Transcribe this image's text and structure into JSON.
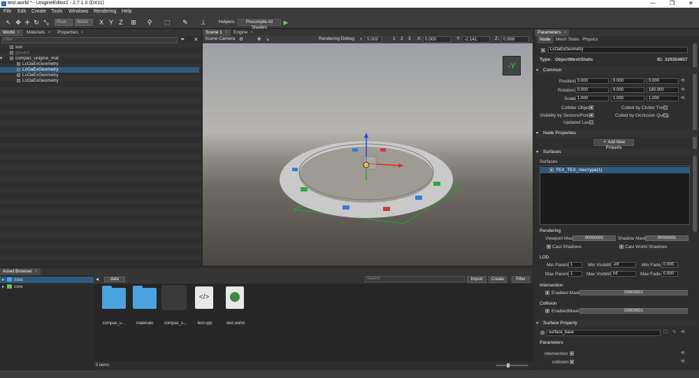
{
  "window": {
    "title": "test.world * - UnigineEditor2 - 2.7.1.0 (DX11)",
    "controls": [
      "—",
      "❐",
      "✕"
    ]
  },
  "menu": [
    "File",
    "Edit",
    "Create",
    "Tools",
    "Windows",
    "Rendering",
    "Help"
  ],
  "toolbar": {
    "pivot": "Pivot",
    "space": "World",
    "axes": [
      "X",
      "Y",
      "Z"
    ],
    "helpers_label": "Helpers",
    "precompile_label": "Precompile All Shaders"
  },
  "world_panel": {
    "tabs": [
      "World",
      "Materials",
      "Properties"
    ],
    "filter_placeholder": "Filter",
    "nodes": [
      {
        "label": "sun",
        "indent": 1,
        "dim": false,
        "selected": false
      },
      {
        "label": "ground",
        "indent": 1,
        "dim": true,
        "selected": false
      },
      {
        "label": "compas_unigine_mat",
        "indent": 1,
        "dim": false,
        "selected": false
      },
      {
        "label": "LcOaExGeometry",
        "indent": 2,
        "dim": false,
        "selected": false
      },
      {
        "label": "LcOaExGeometry",
        "indent": 2,
        "dim": false,
        "selected": true
      },
      {
        "label": "LcOaExGeometry",
        "indent": 2,
        "dim": false,
        "selected": false
      },
      {
        "label": "LcOaExGeometry",
        "indent": 2,
        "dim": false,
        "selected": false
      }
    ]
  },
  "scene": {
    "tabs": [
      "Scene 1",
      "Engine"
    ],
    "camera": "Scene Camera",
    "rendering_debug": "Rendering Debug",
    "speed": "5.000",
    "views": [
      "1",
      "2",
      "3"
    ],
    "coords": {
      "x_label": "X:",
      "x": "0.000",
      "y_label": "Y:",
      "y": "-2.141",
      "z_label": "Z:",
      "z": "0.996"
    },
    "gizmo_cube_label": "-Y"
  },
  "asset_browser": {
    "tab": "Asset Browser",
    "tree": [
      {
        "label": "data",
        "selected": true
      },
      {
        "label": "core",
        "selected": false
      }
    ],
    "path": "data",
    "search_placeholder": "Search",
    "import_label": "Import",
    "create_label": "Create",
    "filter_label": "Filter",
    "items": [
      {
        "label": "compas_u...",
        "kind": "folder"
      },
      {
        "label": "materials",
        "kind": "folder"
      },
      {
        "label": "compas_u...",
        "kind": "mesh"
      },
      {
        "label": "test.cpp",
        "kind": "code"
      },
      {
        "label": "test.world",
        "kind": "world"
      }
    ],
    "count": "5 items"
  },
  "parameters": {
    "tab": "Parameters",
    "subtabs": [
      "Node",
      "Mesh Static",
      "Physics"
    ],
    "node_name": "LcOaExGeometry",
    "type_label": "Type:",
    "type_value": "ObjectMeshStatic",
    "id_label": "ID:",
    "id_value": "329354657",
    "common": {
      "title": "Common",
      "position_label": "Position",
      "position": [
        "0.000",
        "0.000",
        "0.000"
      ],
      "rotation_label": "Rotation",
      "rotation": [
        "0.000",
        "0.000",
        "180.000"
      ],
      "scale_label": "Scale",
      "scale": [
        "1.000",
        "1.000",
        "1.000"
      ],
      "collider_label": "Collider Object",
      "culled_clutter_label": "Culled by Clutter Tree",
      "visibility_sectors_label": "Visibility by Sectors/Portals",
      "culled_occlusion_label": "Culled by Occlusion Query",
      "updated_last_label": "Updated Last"
    },
    "node_properties": {
      "title": "Node Properties",
      "add_label": "Add New Property"
    },
    "surfaces": {
      "title": "Surfaces",
      "list_label": "Surfaces",
      "items": [
        "TEX_TEX_текстура(1)"
      ]
    },
    "rendering": {
      "title": "Rendering",
      "viewport_mask_label": "Viewport Mask",
      "viewport_mask": "00000001",
      "shadow_mask_label": "Shadow Mask",
      "shadow_mask": "00000001",
      "cast_shadows_label": "Cast Shadows",
      "cast_world_shadows_label": "Cast World Shadows"
    },
    "lod": {
      "title": "LOD",
      "min_parent_label": "Min Parent",
      "min_parent": "1",
      "min_visibility_label": "Min Visibility",
      "min_visibility": "-inf",
      "min_fade_label": "Min Fade",
      "min_fade": "0.000",
      "max_parent_label": "Max Parent",
      "max_parent": "1",
      "max_visibility_label": "Max Visibility",
      "max_visibility": "inf",
      "max_fade_label": "Max Fade",
      "max_fade": "0.000"
    },
    "intersection": {
      "title": "Intersection",
      "enabled_mask_label": "Enabled Mask",
      "mask": "00000001"
    },
    "collision": {
      "title": "Collision",
      "enabled_label": "Enabled",
      "mask_label": "Mask",
      "mask": "00000001"
    },
    "surface_property": {
      "title": "Surface Property",
      "value": "surface_base"
    },
    "sp_parameters": {
      "title": "Parameters",
      "intersection_label": "intersection",
      "collision_label": "collision"
    }
  },
  "colors": {
    "accent": "#2f5a80",
    "panel": "#2e2e2e",
    "toolbar": "#3c3c3c"
  }
}
